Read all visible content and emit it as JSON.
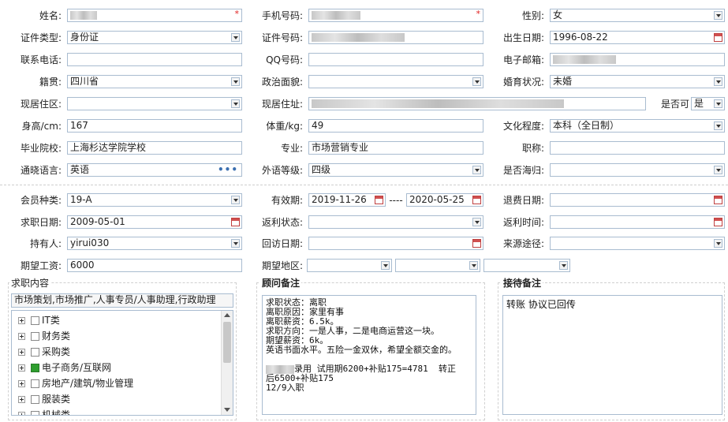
{
  "row1": {
    "name_label": "姓名:",
    "phone_label": "手机号码:",
    "gender_label": "性别:",
    "gender_value": "女",
    "required_mark": "*"
  },
  "row2": {
    "idtype_label": "证件类型:",
    "idtype_value": "身份证",
    "idno_label": "证件号码:",
    "birth_label": "出生日期:",
    "birth_value": "1996-08-22"
  },
  "row3": {
    "contact_label": "联系电话:",
    "qq_label": "QQ号码:",
    "email_label": "电子邮箱:"
  },
  "row4": {
    "native_label": "籍贯:",
    "native_value": "四川省",
    "politics_label": "政治面貌:",
    "marital_label": "婚育状况:",
    "marital_value": "未婚"
  },
  "row5": {
    "area_label": "现居住区:",
    "addr_label": "现居住址:",
    "flag_label": "是否可",
    "flag_value": "是"
  },
  "row6": {
    "height_label": "身高/cm:",
    "height_value": "167",
    "weight_label": "体重/kg:",
    "weight_value": "49",
    "edu_label": "文化程度:",
    "edu_value": "本科（全日制）"
  },
  "row7": {
    "school_label": "毕业院校:",
    "school_value": "上海杉达学院学校",
    "major_label": "专业:",
    "major_value": "市场营销专业",
    "title_label": "职称:"
  },
  "row8": {
    "lang_label": "通晓语言:",
    "lang_value": "英语",
    "lang_more": "•••",
    "level_label": "外语等级:",
    "level_value": "四级",
    "abroad_label": "是否海归:"
  },
  "row9": {
    "member_label": "会员种类:",
    "member_value": "19-A",
    "valid_label": "有效期:",
    "valid_from": "2019-11-26",
    "valid_sep": "----",
    "valid_to": "2020-05-25",
    "refund_label": "退费日期:"
  },
  "row10": {
    "job_date_label": "求职日期:",
    "job_date_value": "2009-05-01",
    "rebate_status_label": "返利状态:",
    "rebate_time_label": "返利时间:"
  },
  "row11": {
    "holder_label": "持有人:",
    "holder_value": "yirui030",
    "visit_label": "回访日期:",
    "source_label": "来源途径:"
  },
  "row12": {
    "salary_label": "期望工资:",
    "salary_value": "6000",
    "region_label": "期望地区:"
  },
  "job_content": {
    "legend": "求职内容",
    "summary": "市场策划,市场推广,人事专员/人事助理,行政助理",
    "tree": [
      {
        "label": "IT类",
        "checked": false
      },
      {
        "label": "财务类",
        "checked": false
      },
      {
        "label": "采购类",
        "checked": false
      },
      {
        "label": "电子商务/互联网",
        "checked": true
      },
      {
        "label": "房地产/建筑/物业管理",
        "checked": false
      },
      {
        "label": "服装类",
        "checked": false
      },
      {
        "label": "机械类",
        "checked": false
      }
    ]
  },
  "advisor_notes": {
    "legend": "顾问备注",
    "text": "求职状态：离职\n离职原因：家里有事\n离职薪资：6.5k。\n求职方向：一是人事，二是电商运营这一块。\n期望薪资：6k。\n英语书面水平。五险一金双休，希望全额交金的。\n\n录用 试用期6200+补贴175=4781  转正\n后6500+补贴175\n12/9入职",
    "blurred_prefix_line": 7
  },
  "reception_notes": {
    "legend": "接待备注",
    "text": "转账 协议已回传"
  }
}
